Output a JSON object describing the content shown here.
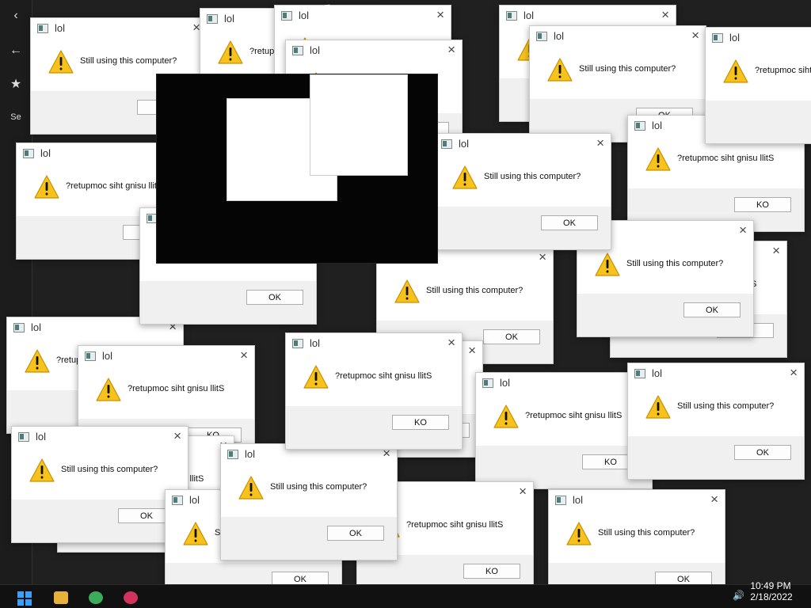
{
  "desktop": {
    "browser_strip": {
      "back": "‹",
      "forward": "←",
      "favorite": "★",
      "search_hint": "Se"
    },
    "taskbar": {
      "time": "10:49 PM",
      "date": "2/18/2022"
    }
  },
  "dialog": {
    "title": "lol",
    "close": "×",
    "msg_forward": "Still using this computer?",
    "msg_reverse": "?retupmoc siht gnisu llitS",
    "ok_forward": "OK",
    "ok_reverse": "KO"
  },
  "colors": {
    "warning_fill": "#f6c21b",
    "warning_stroke": "#c99000",
    "desktop_bg": "#202020",
    "dialog_footer": "#f0f0f0"
  },
  "icons": {
    "window": "app-window-icon",
    "warning": "warning-triangle-icon",
    "close": "close-icon"
  }
}
